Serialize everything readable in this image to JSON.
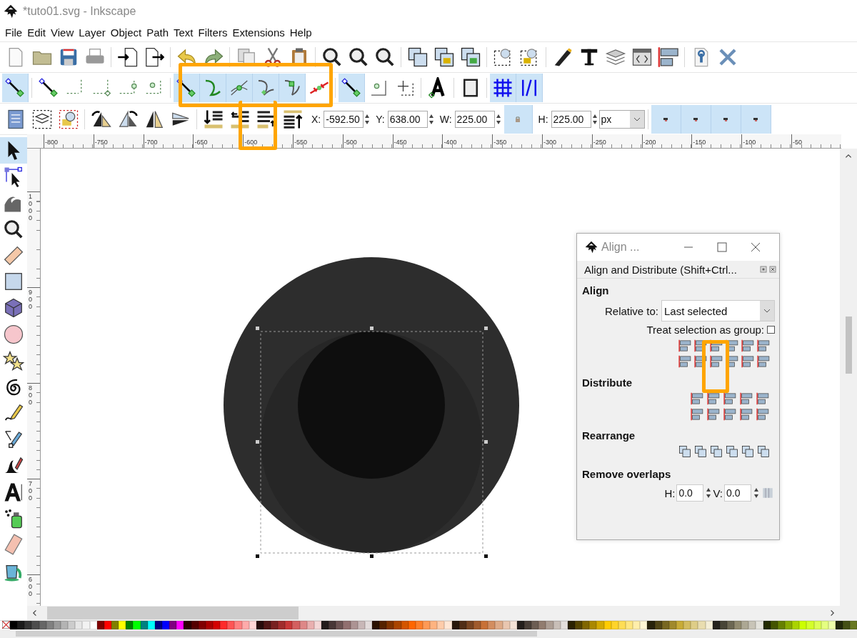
{
  "window": {
    "title": "*tuto01.svg - Inkscape"
  },
  "menu": [
    {
      "label": "File"
    },
    {
      "label": "Edit"
    },
    {
      "label": "View"
    },
    {
      "label": "Layer"
    },
    {
      "label": "Object"
    },
    {
      "label": "Path"
    },
    {
      "label": "Text"
    },
    {
      "label": "Filters"
    },
    {
      "label": "Extensions"
    },
    {
      "label": "Help"
    }
  ],
  "snap_bar": [
    {
      "kind": "snap",
      "on": true
    },
    {
      "kind": "bbox",
      "on": false
    },
    {
      "kind": "edge",
      "on": false
    },
    {
      "kind": "corner",
      "on": false
    },
    {
      "kind": "edge_mid",
      "on": false
    },
    {
      "kind": "center",
      "on": false
    },
    {
      "kind": "node",
      "on": true
    },
    {
      "kind": "path",
      "on": true
    },
    {
      "kind": "intersection",
      "on": true
    },
    {
      "kind": "cusp",
      "on": true
    },
    {
      "kind": "smooth",
      "on": true
    },
    {
      "kind": "midpoint",
      "on": false
    },
    {
      "kind": "others",
      "on": true
    },
    {
      "kind": "object_center",
      "on": false
    },
    {
      "kind": "rotation",
      "on": false
    },
    {
      "kind": "baseline",
      "on": false
    },
    {
      "kind": "page",
      "on": false
    },
    {
      "kind": "grid",
      "on": true
    },
    {
      "kind": "guide",
      "on": true
    }
  ],
  "tool_controls": {
    "x": {
      "label": "X:",
      "value": "-592.50"
    },
    "y": {
      "label": "Y:",
      "value": "638.00"
    },
    "w": {
      "label": "W:",
      "value": "225.00"
    },
    "lock": {
      "on": true
    },
    "h": {
      "label": "H:",
      "value": "225.00"
    },
    "unit": "px",
    "transform_toggles": [
      {
        "on": true
      },
      {
        "on": true
      },
      {
        "on": true
      },
      {
        "on": true
      }
    ]
  },
  "ruler": {
    "horizontal": [
      "-800",
      "-750",
      "-700",
      "-650",
      "-600",
      "-550",
      "-500",
      "-450",
      "-400",
      "-350",
      "-300",
      "-250",
      "-200",
      "-150",
      "-100",
      "-50"
    ],
    "vertical": [
      "1000",
      "900",
      "800",
      "700",
      "600"
    ]
  },
  "toolbox": [
    {
      "kind": "selector",
      "selected": true
    },
    {
      "kind": "node",
      "selected": false
    },
    {
      "kind": "tweak",
      "selected": false
    },
    {
      "kind": "zoom",
      "selected": false
    },
    {
      "kind": "measure",
      "selected": false
    },
    {
      "kind": "rect",
      "selected": false
    },
    {
      "kind": "box3d",
      "selected": false
    },
    {
      "kind": "ellipse",
      "selected": false
    },
    {
      "kind": "star",
      "selected": false
    },
    {
      "kind": "spiral",
      "selected": false
    },
    {
      "kind": "pencil",
      "selected": false
    },
    {
      "kind": "pen",
      "selected": false
    },
    {
      "kind": "calligraphy",
      "selected": false
    },
    {
      "kind": "text",
      "selected": false
    },
    {
      "kind": "spray",
      "selected": false
    },
    {
      "kind": "eraser",
      "selected": false
    },
    {
      "kind": "bucket",
      "selected": false
    }
  ],
  "align_dialog": {
    "title": "Align ...",
    "panel_title": "Align and Distribute (Shift+Ctrl...",
    "align_heading": "Align",
    "relative_label": "Relative to:",
    "relative_value": "Last selected",
    "treat_label": "Treat selection as group:",
    "treat_checked": false,
    "distribute_heading": "Distribute",
    "rearrange_heading": "Rearrange",
    "overlaps_heading": "Remove overlaps",
    "h_label": "H:",
    "h_value": "0.0",
    "v_label": "V:",
    "v_value": "0.0"
  },
  "palette": [
    {
      "color": "#000000"
    },
    {
      "color": "#1a1a1a"
    },
    {
      "color": "#333333"
    },
    {
      "color": "#4d4d4d"
    },
    {
      "color": "#666666"
    },
    {
      "color": "#808080"
    },
    {
      "color": "#999999"
    },
    {
      "color": "#b3b3b3"
    },
    {
      "color": "#cccccc"
    },
    {
      "color": "#e6e6e6"
    },
    {
      "color": "#f2f2f2"
    },
    {
      "color": "#ffffff"
    },
    {
      "color": "#800000"
    },
    {
      "color": "#ff0000"
    },
    {
      "color": "#808000"
    },
    {
      "color": "#ffff00"
    },
    {
      "color": "#008000"
    },
    {
      "color": "#00ff00"
    },
    {
      "color": "#008080"
    },
    {
      "color": "#00ffff"
    },
    {
      "color": "#000080"
    },
    {
      "color": "#0000ff"
    },
    {
      "color": "#800080"
    },
    {
      "color": "#ff00ff"
    },
    {
      "color": "#2b0000"
    },
    {
      "color": "#550000"
    },
    {
      "color": "#800001"
    },
    {
      "color": "#aa0000"
    },
    {
      "color": "#d40000"
    },
    {
      "color": "#ff2a2a"
    },
    {
      "color": "#ff5555"
    },
    {
      "color": "#ff8080"
    },
    {
      "color": "#ffaaaa"
    },
    {
      "color": "#ffd5d5"
    },
    {
      "color": "#280b0b"
    },
    {
      "color": "#501616"
    },
    {
      "color": "#782121"
    },
    {
      "color": "#a02c2c"
    },
    {
      "color": "#c83737"
    },
    {
      "color": "#d35f5f"
    },
    {
      "color": "#de8787"
    },
    {
      "color": "#e9afaf"
    },
    {
      "color": "#f4d7d7"
    },
    {
      "color": "#241c1c"
    },
    {
      "color": "#483737"
    },
    {
      "color": "#6c5353"
    },
    {
      "color": "#916f6f"
    },
    {
      "color": "#ac9393"
    },
    {
      "color": "#c8b7b7"
    },
    {
      "color": "#e3dbdb"
    },
    {
      "color": "#2b1100"
    },
    {
      "color": "#552200"
    },
    {
      "color": "#803300"
    },
    {
      "color": "#aa4400"
    },
    {
      "color": "#d45500"
    },
    {
      "color": "#ff6600"
    },
    {
      "color": "#ff7f2a"
    },
    {
      "color": "#ff9955"
    },
    {
      "color": "#ffb380"
    },
    {
      "color": "#ffccaa"
    },
    {
      "color": "#ffe6d5"
    },
    {
      "color": "#28170b"
    },
    {
      "color": "#502d16"
    },
    {
      "color": "#784421"
    },
    {
      "color": "#a05a2c"
    },
    {
      "color": "#c87137"
    },
    {
      "color": "#d38d5f"
    },
    {
      "color": "#deaa87"
    },
    {
      "color": "#e9c6af"
    },
    {
      "color": "#f4e3d7"
    },
    {
      "color": "#241f1c"
    },
    {
      "color": "#483e37"
    },
    {
      "color": "#6c5d53"
    },
    {
      "color": "#917c6f"
    },
    {
      "color": "#ac9d93"
    },
    {
      "color": "#c8beb7"
    },
    {
      "color": "#e3dedb"
    },
    {
      "color": "#2b2200"
    },
    {
      "color": "#554400"
    },
    {
      "color": "#806600"
    },
    {
      "color": "#aa8800"
    },
    {
      "color": "#d4aa00"
    },
    {
      "color": "#ffcc00"
    },
    {
      "color": "#ffd42a"
    },
    {
      "color": "#ffdd55"
    },
    {
      "color": "#ffe680"
    },
    {
      "color": "#ffeeaa"
    },
    {
      "color": "#fff6d5"
    },
    {
      "color": "#28220b"
    },
    {
      "color": "#504416"
    },
    {
      "color": "#786721"
    },
    {
      "color": "#a0892c"
    },
    {
      "color": "#c8ab37"
    },
    {
      "color": "#d3bc5f"
    },
    {
      "color": "#decd87"
    },
    {
      "color": "#e9ddaf"
    },
    {
      "color": "#f4eed7"
    },
    {
      "color": "#24221c"
    },
    {
      "color": "#484537"
    },
    {
      "color": "#6c6753"
    },
    {
      "color": "#918a6f"
    },
    {
      "color": "#aca793"
    },
    {
      "color": "#c8c4b7"
    },
    {
      "color": "#e3e2db"
    },
    {
      "color": "#222b00"
    },
    {
      "color": "#445500"
    },
    {
      "color": "#668000"
    },
    {
      "color": "#88aa00"
    },
    {
      "color": "#aad400"
    },
    {
      "color": "#ccff00"
    },
    {
      "color": "#d4ff2a"
    },
    {
      "color": "#ddff55"
    },
    {
      "color": "#e5ff80"
    },
    {
      "color": "#eeffaa"
    },
    {
      "color": "#22280b"
    },
    {
      "color": "#445016"
    },
    {
      "color": "#677821"
    }
  ]
}
